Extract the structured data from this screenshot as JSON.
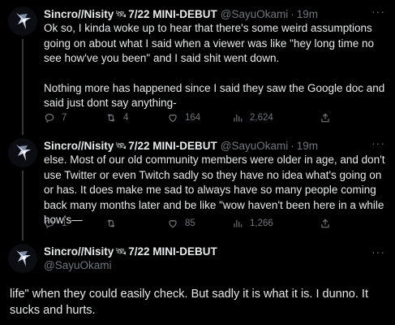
{
  "tweets": [
    {
      "name": "Sincro//Nisity",
      "name_suffix": "7/22 MINI-DEBUT",
      "handle": "@SayuOkami",
      "separator": "·",
      "time": "19m",
      "more": "···",
      "paragraphs": [
        "Ok so, I kinda woke up to hear that there's some weird assumptions going on about what I said when a viewer was like \"hey long time no see how've you been\" and I said shit went down.",
        "Nothing more has happened since I said they saw the Google doc and said just dont say anything-"
      ],
      "stats": {
        "replies": "7",
        "retweets": "4",
        "likes": "164",
        "views": "2,624"
      }
    },
    {
      "name": "Sincro//Nisity",
      "name_suffix": "7/22 MINI-DEBUT",
      "handle": "@SayuOkami",
      "separator": "·",
      "time": "19m",
      "more": "···",
      "paragraphs": [
        "else. Most of our old community members were older in age, and don't use Twitter or even Twitch sadly so they have no idea what's going on or has. It does make me sad to always have so many people coming back many months later and be like \"wow haven't been here in a while how's—"
      ],
      "stats": {
        "replies": "1",
        "retweets": "",
        "likes": "85",
        "views": "1,266"
      }
    },
    {
      "name": "Sincro//Nisity",
      "name_suffix": "7/22 MINI-DEBUT",
      "handle": "@SayuOkami",
      "more": "···",
      "text": "life\" when they could easily check. But sadly it is what it is. I dunno. It sucks and hurts."
    }
  ],
  "icons": {
    "reply": "reply-icon",
    "retweet": "retweet-icon",
    "like": "heart-icon",
    "views": "views-icon",
    "share": "share-icon",
    "badge": "satellite-icon"
  },
  "colors": {
    "background": "#000000",
    "text": "#e7e9ea",
    "muted": "#71767b",
    "thread_line": "#333639"
  }
}
